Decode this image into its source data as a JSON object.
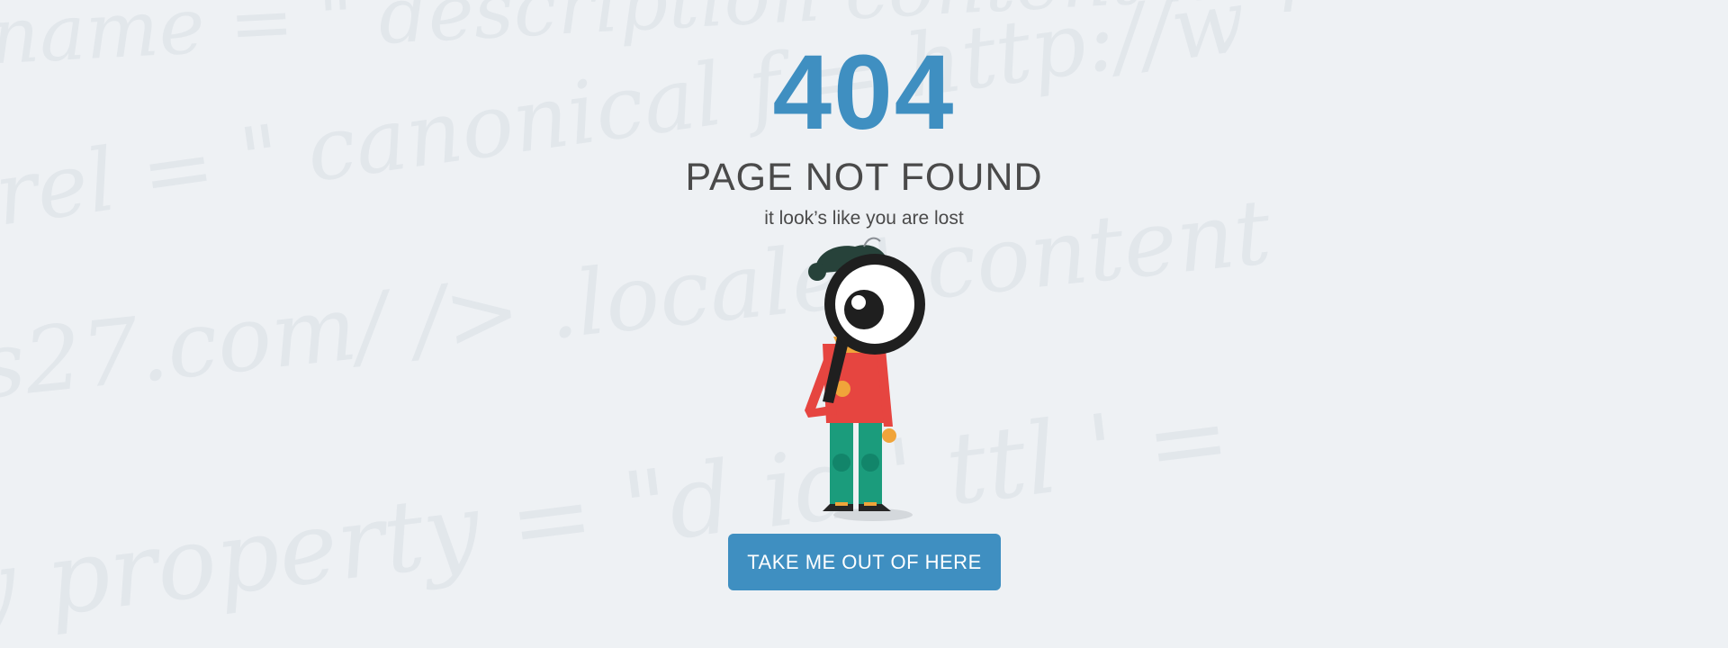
{
  "error": {
    "code": "404",
    "title": "PAGE NOT FOUND",
    "subtitle": "it look’s like you are lost"
  },
  "actions": {
    "primary_button_label": "TAKE ME OUT OF HERE"
  },
  "colors": {
    "accent": "#3f8fc1",
    "text": "#4a4a4a",
    "background": "#eef1f4"
  },
  "illustration": {
    "name": "character-with-magnifying-glass"
  }
}
